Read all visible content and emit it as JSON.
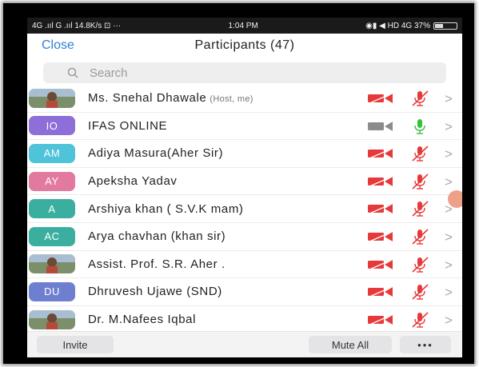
{
  "status_bar": {
    "left": "4G .ııl G .ııl 14.8K/s ⊡ ···",
    "time": "1:04 PM",
    "right": "◉▮ ◀ HD 4G 37%",
    "battery_level": 0.37
  },
  "header": {
    "close_label": "Close",
    "title": "Participants (47)"
  },
  "search": {
    "placeholder": "Search"
  },
  "colors": {
    "accent": "#2f7fd8",
    "muted_red": "#e8393a",
    "mic_green": "#3bbf3b"
  },
  "participants": [
    {
      "avatar_type": "photo",
      "initials": "",
      "name": "Ms. Snehal Dhawale",
      "role": "(Host, me)",
      "video": "off",
      "mic": "muted"
    },
    {
      "avatar_type": "initials",
      "initials": "IO",
      "avatar_color": "#8e6ed8",
      "name": "IFAS ONLINE",
      "role": "",
      "video": "on",
      "mic": "on"
    },
    {
      "avatar_type": "initials",
      "initials": "AM",
      "avatar_color": "#4fc3d8",
      "name": "Adiya Masura(Aher Sir)",
      "role": "",
      "video": "off",
      "mic": "muted"
    },
    {
      "avatar_type": "initials",
      "initials": "AY",
      "avatar_color": "#e27aa0",
      "name": "Apeksha Yadav",
      "role": "",
      "video": "off",
      "mic": "muted"
    },
    {
      "avatar_type": "initials",
      "initials": "A",
      "avatar_color": "#3aaf9f",
      "name": "Arshiya  khan ( S.V.K mam)",
      "role": "",
      "video": "off",
      "mic": "muted"
    },
    {
      "avatar_type": "initials",
      "initials": "AC",
      "avatar_color": "#3aaf9f",
      "name": "Arya chavhan (khan sir)",
      "role": "",
      "video": "off",
      "mic": "muted"
    },
    {
      "avatar_type": "photo",
      "initials": "",
      "name": "Assist. Prof. S.R. Aher .",
      "role": "",
      "video": "off",
      "mic": "muted"
    },
    {
      "avatar_type": "initials",
      "initials": "DU",
      "avatar_color": "#6f7fd0",
      "name": "Dhruvesh Ujawe (SND)",
      "role": "",
      "video": "off",
      "mic": "muted"
    },
    {
      "avatar_type": "photo",
      "initials": "",
      "name": "Dr. M.Nafees Iqbal",
      "role": "",
      "video": "off",
      "mic": "muted"
    }
  ],
  "icons": {
    "video": "video-camera-icon",
    "mic": "microphone-icon",
    "chevron": "chevron-right-icon"
  },
  "footer": {
    "invite_label": "Invite",
    "mute_all_label": "Mute All",
    "more_label": "•••"
  }
}
